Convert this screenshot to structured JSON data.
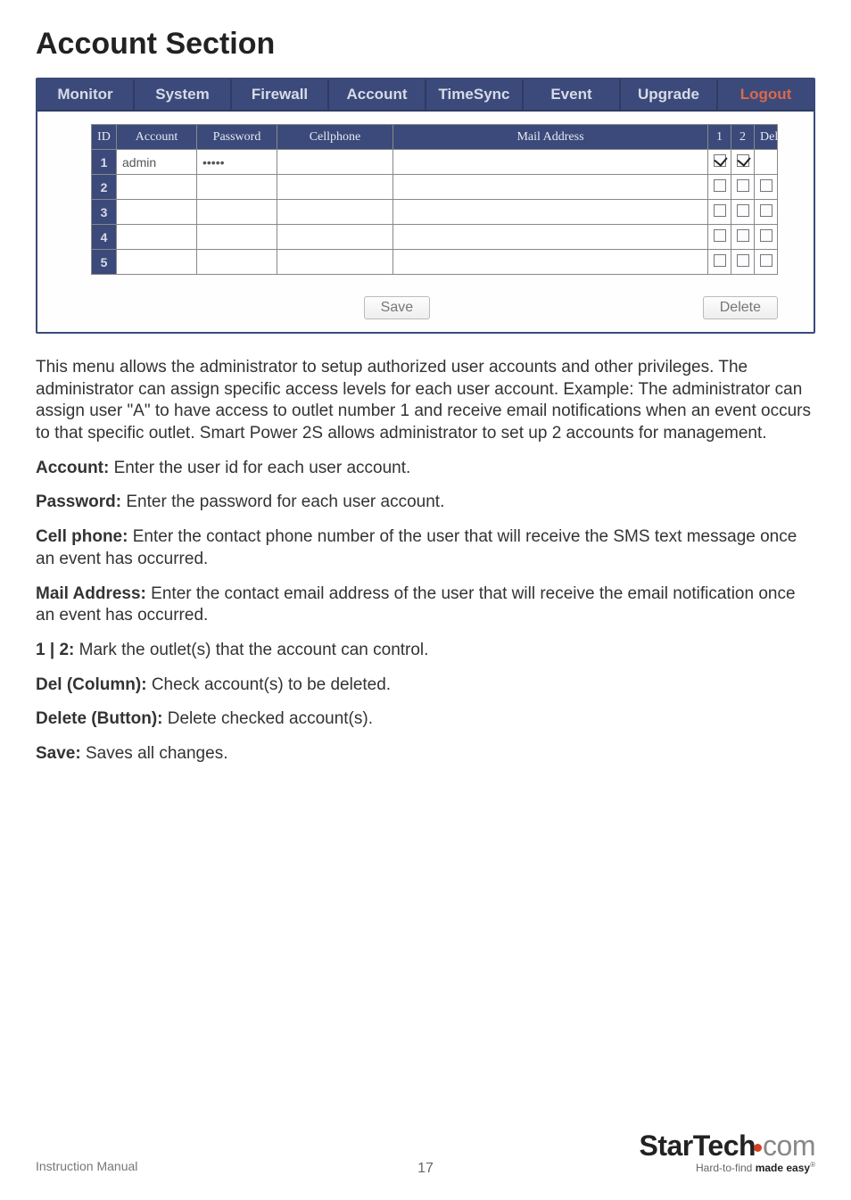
{
  "page": {
    "title": "Account Section",
    "footer_label": "Instruction Manual",
    "page_number": "17"
  },
  "brand": {
    "name_main": "StarTech",
    "name_ext": "com",
    "tagline_plain": "Hard-to-find ",
    "tagline_bold": "made easy",
    "tagline_mark": "®"
  },
  "tabs": {
    "monitor": "Monitor",
    "system": "System",
    "firewall": "Firewall",
    "account": "Account",
    "timesync": "TimeSync",
    "event": "Event",
    "upgrade": "Upgrade",
    "logout": "Logout"
  },
  "table": {
    "headers": {
      "id": "ID",
      "account": "Account",
      "password": "Password",
      "cellphone": "Cellphone",
      "mail": "Mail Address",
      "c1": "1",
      "c2": "2",
      "del": "Del"
    },
    "rows": [
      {
        "id": "1",
        "account": "admin",
        "password": "•••••",
        "cellphone": "",
        "mail": "",
        "c1": true,
        "c2": true,
        "del": null
      },
      {
        "id": "2",
        "account": "",
        "password": "",
        "cellphone": "",
        "mail": "",
        "c1": false,
        "c2": false,
        "del": false
      },
      {
        "id": "3",
        "account": "",
        "password": "",
        "cellphone": "",
        "mail": "",
        "c1": false,
        "c2": false,
        "del": false
      },
      {
        "id": "4",
        "account": "",
        "password": "",
        "cellphone": "",
        "mail": "",
        "c1": false,
        "c2": false,
        "del": false
      },
      {
        "id": "5",
        "account": "",
        "password": "",
        "cellphone": "",
        "mail": "",
        "c1": false,
        "c2": false,
        "del": false
      }
    ],
    "buttons": {
      "save": "Save",
      "del": "Delete"
    }
  },
  "copy": {
    "intro": "This menu allows the administrator to setup authorized user accounts and other privileges. The administrator can assign specific access levels for each user account. Example: The administrator can assign user \"A\" to have access to outlet number 1 and receive email notifications when an event occurs to that specific outlet. Smart Power 2S allows administrator to set up 2 accounts for management.",
    "items": {
      "account_l": "Account:",
      "account_t": " Enter the user id for each user account.",
      "password_l": "Password:",
      "password_t": " Enter the password for each user account.",
      "cell_l": "Cell phone:",
      "cell_t": " Enter the contact phone number of the user that will receive the SMS text message once an event has occurred.",
      "mail_l": "Mail Address:",
      "mail_t": " Enter the contact email address of the user that will receive the email notification once an event has occurred.",
      "one2_l": "1 | 2:",
      "one2_t": " Mark the outlet(s) that the account can control.",
      "delc_l": "Del (Column):",
      "delc_t": " Check account(s) to be deleted.",
      "delb_l": "Delete (Button):",
      "delb_t": " Delete checked account(s).",
      "save_l": "Save:",
      "save_t": " Saves all changes."
    }
  }
}
